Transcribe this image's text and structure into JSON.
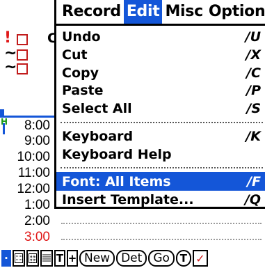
{
  "menubar": {
    "items": [
      {
        "label": "Record"
      },
      {
        "label": "Edit"
      },
      {
        "label": "Misc"
      },
      {
        "label": "Options"
      }
    ],
    "active": "Edit"
  },
  "left_column": {
    "todo_first_char": "C",
    "times": [
      "8:00",
      "9:00",
      "10:00",
      "11:00",
      "12:00",
      "1:00",
      "2:00",
      "3:00"
    ],
    "priority_marks": [
      "!",
      "~",
      "~"
    ],
    "row_marker": "H"
  },
  "edit_menu": {
    "items": [
      {
        "label": "Undo",
        "shortcut": "/U"
      },
      {
        "label": "Cut",
        "shortcut": "/X"
      },
      {
        "label": "Copy",
        "shortcut": "/C"
      },
      {
        "label": "Paste",
        "shortcut": "/P"
      },
      {
        "label": "Select All",
        "shortcut": "/S"
      },
      {
        "label": "Keyboard",
        "shortcut": "/K"
      },
      {
        "label": "Keyboard Help",
        "shortcut": ""
      },
      {
        "label": "Font: All Items",
        "shortcut": "/F"
      },
      {
        "label": "Insert Template...",
        "shortcut": "/Q"
      }
    ],
    "highlighted": "Font: All Items"
  },
  "toolbar": {
    "view_icons": [
      "day-view-icon",
      "week-view-icon",
      "month-view-icon",
      "agenda-view-icon",
      "todo-view-icon",
      "goto-icon"
    ],
    "t_label": "T",
    "new_label": "New",
    "details_label": "Det",
    "go_label": "Go",
    "today_label": "T",
    "check_label": "✓"
  },
  "colors": {
    "accent": "#1456d8",
    "red": "#e01818",
    "green": "#1a9a1a"
  }
}
